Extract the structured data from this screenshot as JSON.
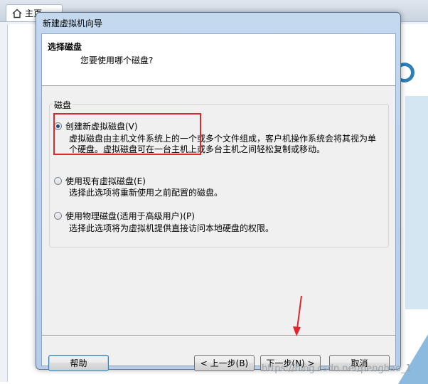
{
  "background_app": {
    "tab_label": "主页"
  },
  "dialog": {
    "title": "新建虚拟机向导",
    "header_title": "选择磁盘",
    "header_subtitle": "您要使用哪个磁盘?",
    "group_label": "磁盘",
    "options": [
      {
        "label": "创建新虚拟磁盘(V)",
        "selected": true,
        "description_line1": "虚拟磁盘由主机文件系统上的一个或多个文件组成，客户机操作系统会将其视为单",
        "description_line2": "个硬盘。虚拟磁盘可在一台主机上或多台主机之间轻松复制或移动。"
      },
      {
        "label": "使用现有虚拟磁盘(E)",
        "selected": false,
        "description_line1": "选择此选项将重新使用之前配置的磁盘。"
      },
      {
        "label": "使用物理磁盘(适用于高级用户)(P)",
        "selected": false,
        "description_line1": "选择此选项将为虚拟机提供直接访问本地硬盘的权限。"
      }
    ],
    "buttons": {
      "help": "帮助",
      "back": "< 上一步(B)",
      "next": "下一步(N) >",
      "cancel": "取消"
    }
  },
  "annotations": {
    "highlight_color": "#e0252b",
    "arrow_color": "#e0252b"
  },
  "watermark": "https://blog.csdn.net/penghao_1"
}
